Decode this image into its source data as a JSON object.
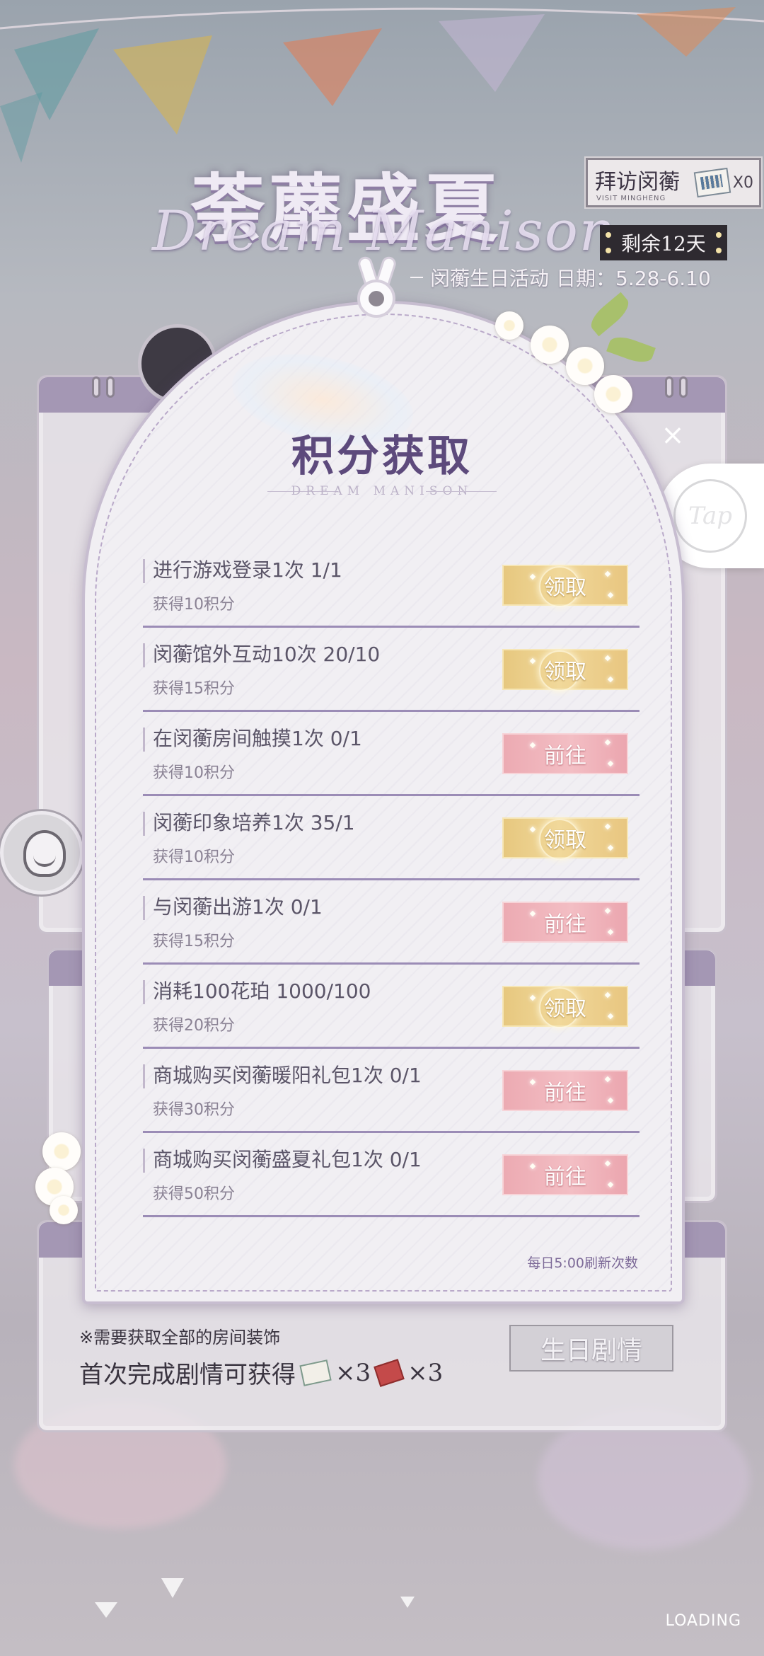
{
  "banner": {
    "title": "荼蘼盛夏",
    "script": "Dream Manison",
    "visit_label": "拜访闵蘅",
    "visit_sub": "VISIT MINGHENG",
    "visit_count": "X0",
    "remaining": "剩余12天",
    "event_name": "闵蘅生日活动",
    "event_date": "日期：5.28-6.10"
  },
  "modal": {
    "title": "积分获取",
    "subtitle": "DREAM MANISON",
    "refresh_note": "每日5:00刷新次数",
    "tasks": [
      {
        "name": "进行游戏登录1次 1/1",
        "points": "获得10积分",
        "button": "领取",
        "state": "claim"
      },
      {
        "name": "闵蘅馆外互动10次 20/10",
        "points": "获得15积分",
        "button": "领取",
        "state": "claim"
      },
      {
        "name": "在闵蘅房间触摸1次 0/1",
        "points": "获得10积分",
        "button": "前往",
        "state": "goto"
      },
      {
        "name": "闵蘅印象培养1次 35/1",
        "points": "获得10积分",
        "button": "领取",
        "state": "claim"
      },
      {
        "name": "与闵蘅出游1次 0/1",
        "points": "获得15积分",
        "button": "前往",
        "state": "goto"
      },
      {
        "name": "消耗100花珀 1000/100",
        "points": "获得20积分",
        "button": "领取",
        "state": "claim"
      },
      {
        "name": "商城购买闵蘅暖阳礼包1次 0/1",
        "points": "获得30积分",
        "button": "前往",
        "state": "goto"
      },
      {
        "name": "商城购买闵蘅盛夏礼包1次 0/1",
        "points": "获得50积分",
        "button": "前往",
        "state": "goto"
      }
    ]
  },
  "background": {
    "note": "※需要获取全部的房间装饰",
    "first_reward": "首次完成剧情可获得",
    "reward_a": "×3",
    "reward_b": "×3",
    "birthday_button": "生日剧情",
    "tap_label": "Tap"
  },
  "footer": {
    "loading": "LOADING"
  },
  "colors": {
    "accent_purple": "#5d4a7c",
    "claim_gold": "#e6c77e",
    "goto_pink": "#ecaab2"
  }
}
